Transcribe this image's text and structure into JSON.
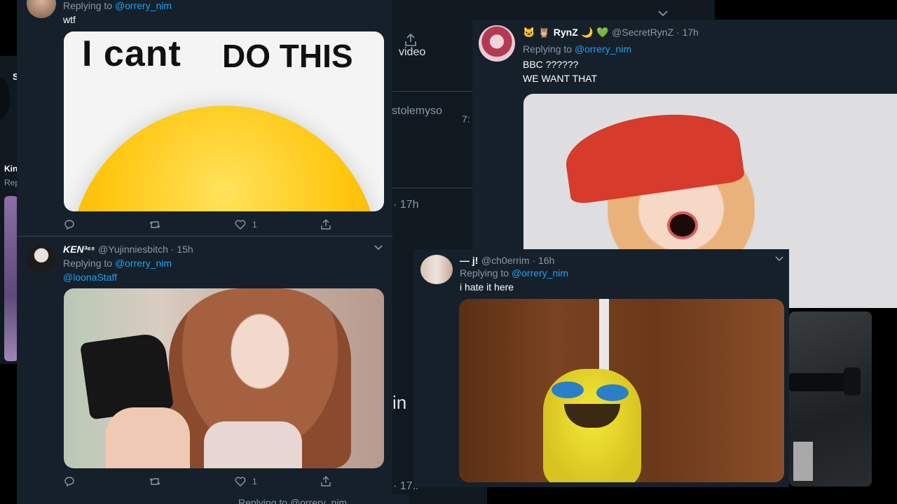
{
  "tweet_wtf": {
    "reply_prefix": "Replying to",
    "reply_mention": "@orrery_nim",
    "text": "wtf",
    "image_text_left": "I cant",
    "image_text_right": "DO THIS",
    "like_count": "1"
  },
  "tweet_ken": {
    "name": "KEN³⁶⁵",
    "handle_time": "@Yujinniesbitch · 15h",
    "reply_prefix": "Replying to",
    "reply_mention": "@orrery_nim",
    "text": "@loonaStaff",
    "like_count": "1"
  },
  "tweet_rynz": {
    "name": "RynZ",
    "handle_time": "@SecretRynZ · 17h",
    "reply_prefix": "Replying to",
    "reply_mention": "@orrery_nim",
    "text_line1": "BBC ??????",
    "text_line2": "WE WANT THAT"
  },
  "tweet_j": {
    "name": "— j!",
    "handle_time": "@ch0errim · 16h",
    "reply_prefix": "Replying to",
    "reply_mention": "@orrery_nim",
    "text": "i hate it here"
  },
  "background": {
    "video_fragment": "video",
    "handle_fragment": "stolemyso",
    "time_fragment": "· 17h",
    "time_fragment2": "· 17..",
    "win_fragment": "in",
    "left_name": "Kin",
    "left_sub": "Rep",
    "bottom_reply": "Replying to @orrery_nim",
    "small_a": "7:",
    "small_b": "S"
  },
  "colors": {
    "panel": "#15202b",
    "mention": "#1da1f2",
    "muted": "#8899a6"
  }
}
